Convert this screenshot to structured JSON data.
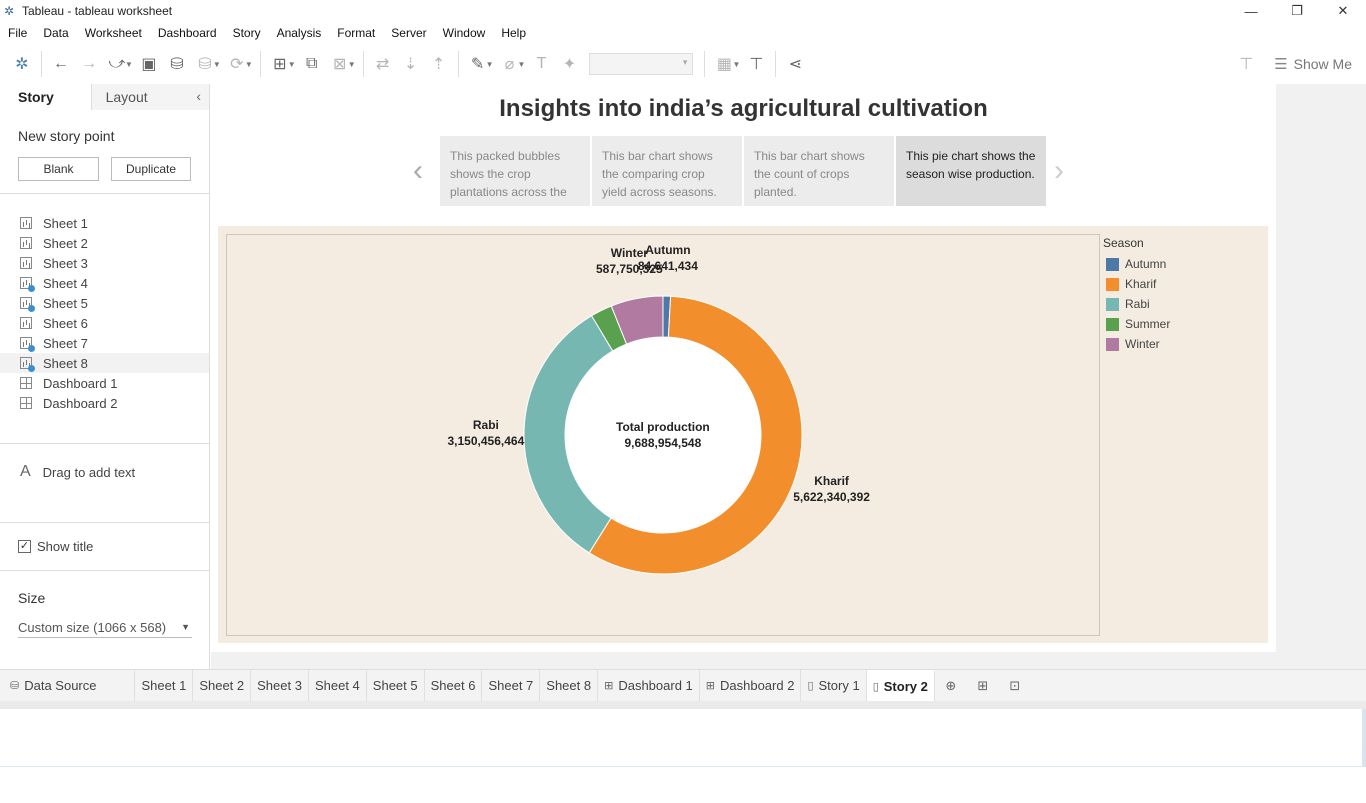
{
  "window": {
    "title": "Tableau - tableau worksheet",
    "minimize": "—",
    "restore": "❐",
    "close": "✕"
  },
  "menu": [
    "File",
    "Data",
    "Worksheet",
    "Dashboard",
    "Story",
    "Analysis",
    "Format",
    "Server",
    "Window",
    "Help"
  ],
  "toolbar": {
    "show_me": "Show Me"
  },
  "left_pane": {
    "tab_story": "Story",
    "tab_layout": "Layout",
    "new_story_point": "New story point",
    "blank_button": "Blank",
    "duplicate_button": "Duplicate",
    "sheets": [
      {
        "label": "Sheet 1",
        "type": "chart",
        "check": false
      },
      {
        "label": "Sheet 2",
        "type": "chart",
        "check": false
      },
      {
        "label": "Sheet 3",
        "type": "chart",
        "check": false
      },
      {
        "label": "Sheet 4",
        "type": "chart",
        "check": true
      },
      {
        "label": "Sheet 5",
        "type": "chart",
        "check": true
      },
      {
        "label": "Sheet 6",
        "type": "chart",
        "check": false
      },
      {
        "label": "Sheet 7",
        "type": "chart",
        "check": true
      },
      {
        "label": "Sheet 8",
        "type": "chart",
        "check": true
      },
      {
        "label": "Dashboard 1",
        "type": "dash",
        "check": false
      },
      {
        "label": "Dashboard 2",
        "type": "dash",
        "check": false
      }
    ],
    "drag_text": "Drag to add text",
    "show_title": "Show title",
    "size_label": "Size",
    "size_value": "Custom size (1066 x 568)"
  },
  "story": {
    "title": "Insights into india’s agricultural cultivation",
    "points": [
      {
        "text": "This packed bubbles shows the crop plantations across the",
        "active": false
      },
      {
        "text": "This bar chart shows the comparing crop yield across seasons.",
        "active": false
      },
      {
        "text": "This bar chart shows the count of crops planted.",
        "active": false
      },
      {
        "text": "This pie chart shows the season wise production.",
        "active": true
      }
    ]
  },
  "chart_data": {
    "type": "pie",
    "style": "donut",
    "slices": [
      {
        "name": "Autumn",
        "value": 84641434,
        "label": "84,641,434",
        "color": "#4e79a7"
      },
      {
        "name": "Kharif",
        "value": 5622340392,
        "label": "5,622,340,392",
        "color": "#f28e2b"
      },
      {
        "name": "Rabi",
        "value": 3150456464,
        "label": "3,150,456,464",
        "color": "#76b7b2"
      },
      {
        "name": "Summer",
        "value": 243766933,
        "label": "",
        "color": "#59a14f"
      },
      {
        "name": "Winter",
        "value": 587750325,
        "label": "587,750,325",
        "color": "#b07aa1"
      }
    ],
    "center_title": "Total production",
    "center_value": "9,688,954,548",
    "legend_title": "Season"
  },
  "bottom_tabs": [
    {
      "label": "Data Source",
      "icon": "datasource"
    },
    {
      "label": "Sheet 1",
      "icon": ""
    },
    {
      "label": "Sheet 2",
      "icon": ""
    },
    {
      "label": "Sheet 3",
      "icon": ""
    },
    {
      "label": "Sheet 4",
      "icon": ""
    },
    {
      "label": "Sheet 5",
      "icon": ""
    },
    {
      "label": "Sheet 6",
      "icon": ""
    },
    {
      "label": "Sheet 7",
      "icon": ""
    },
    {
      "label": "Sheet 8",
      "icon": ""
    },
    {
      "label": "Dashboard 1",
      "icon": "dashboard"
    },
    {
      "label": "Dashboard 2",
      "icon": "dashboard"
    },
    {
      "label": "Story 1",
      "icon": "story"
    },
    {
      "label": "Story 2",
      "icon": "story",
      "active": true
    }
  ]
}
